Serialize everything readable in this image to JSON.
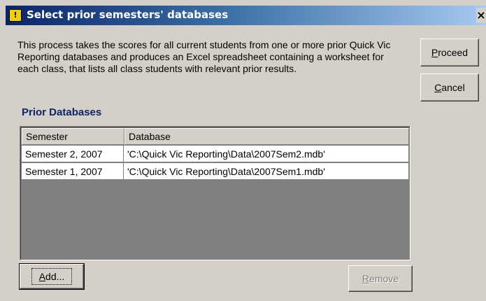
{
  "window": {
    "title": "Select prior semesters' databases",
    "close_glyph": "×",
    "icon": "app-icon"
  },
  "description": "This process takes the scores for all current students from one or more prior Quick Vic Reporting databases and produces an Excel spreadsheet containing a worksheet for each class, that lists all class students with relevant prior results.",
  "buttons": {
    "proceed": {
      "mnemonic": "P",
      "rest": "roceed"
    },
    "cancel": {
      "mnemonic": "C",
      "rest": "ancel"
    },
    "add": {
      "mnemonic": "A",
      "rest": "dd..."
    },
    "remove": {
      "mnemonic": "R",
      "rest": "emove",
      "enabled": false
    }
  },
  "section_title": "Prior Databases",
  "table": {
    "columns": [
      "Semester",
      "Database"
    ],
    "rows": [
      {
        "semester": "Semester 2, 2007",
        "database": "'C:\\Quick Vic Reporting\\Data\\2007Sem2.mdb'"
      },
      {
        "semester": "Semester 1, 2007",
        "database": "'C:\\Quick Vic Reporting\\Data\\2007Sem1.mdb'"
      }
    ]
  },
  "colors": {
    "title_start": "#0a246a",
    "title_end": "#a6caf0",
    "section_title": "#0a246a",
    "face": "#d4d0c8"
  }
}
